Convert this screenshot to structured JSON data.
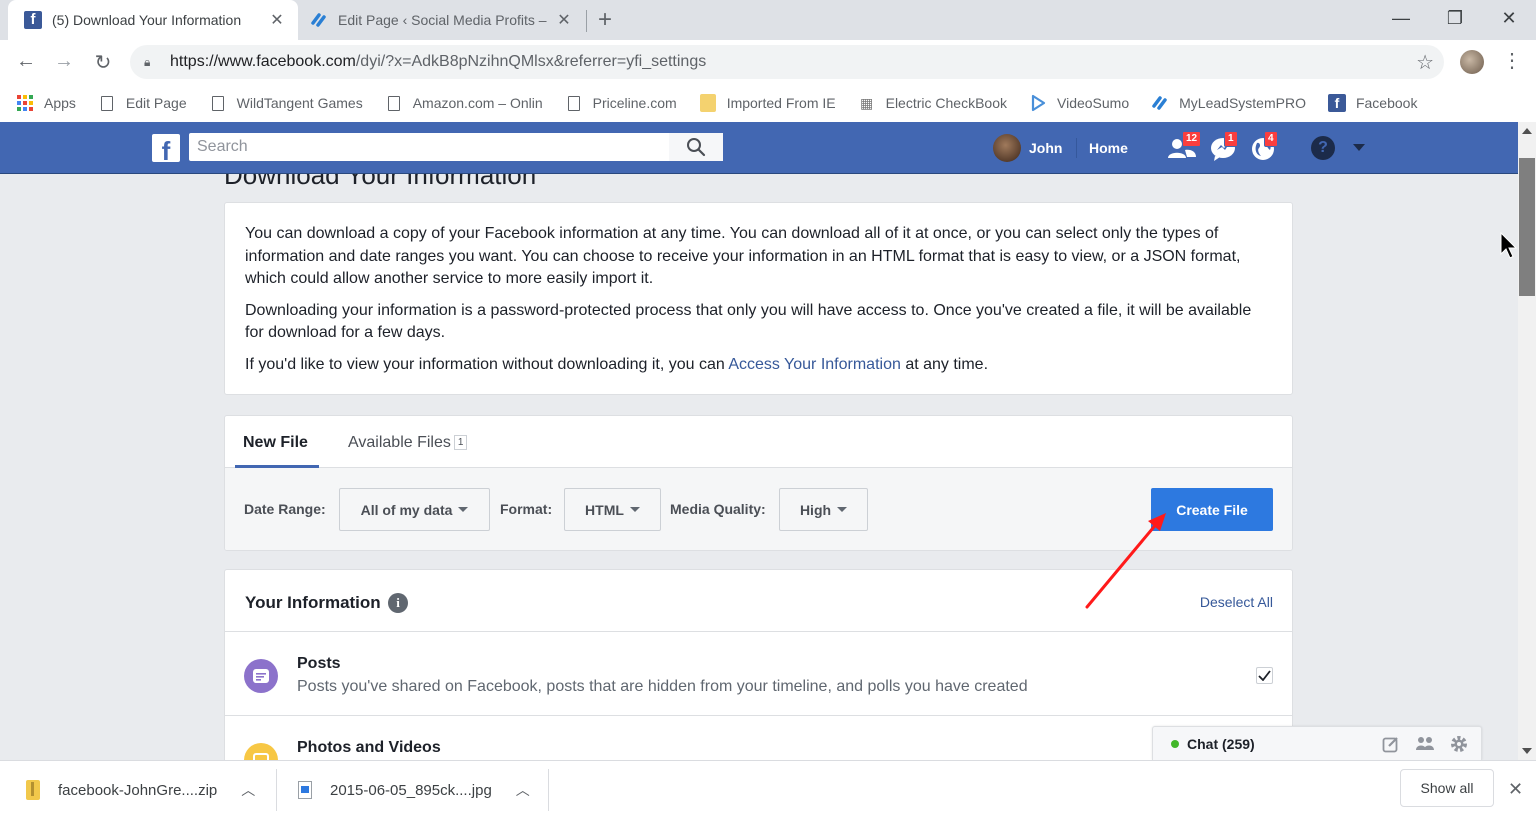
{
  "browser": {
    "tabs": [
      {
        "title": "(5) Download Your Information",
        "active": true,
        "icon": "facebook-icon"
      },
      {
        "title": "Edit Page ‹ Social Media Profits –",
        "active": false,
        "icon": "link-icon"
      }
    ],
    "new_tab_label": "+",
    "window_controls": {
      "minimize": "—",
      "restore": "❐",
      "close": "✕"
    },
    "url_host": "https://www.facebook.com",
    "url_path": "/dyi/?x=AdkB8pNzihnQMlsx&referrer=yfi_settings",
    "bookmarks": [
      {
        "label": "Apps",
        "icon": "apps-grid-icon"
      },
      {
        "label": "Edit Page",
        "icon": "page-icon"
      },
      {
        "label": "WildTangent Games",
        "icon": "page-icon"
      },
      {
        "label": "Amazon.com – Onlin",
        "icon": "page-icon"
      },
      {
        "label": "Priceline.com",
        "icon": "page-icon"
      },
      {
        "label": "Imported From IE",
        "icon": "folder-icon"
      },
      {
        "label": "Electric CheckBook",
        "icon": "checkbook-icon"
      },
      {
        "label": "VideoSumo",
        "icon": "play-icon"
      },
      {
        "label": "MyLeadSystemPRO",
        "icon": "link-icon"
      },
      {
        "label": "Facebook",
        "icon": "facebook-icon"
      }
    ]
  },
  "facebook": {
    "search_placeholder": "Search",
    "user_name": "John",
    "home_label": "Home",
    "notifications": {
      "friend_requests": "12",
      "messages": "1",
      "notifications": "4"
    },
    "help_label": "?"
  },
  "page": {
    "title": "Download Your Information",
    "intro": {
      "p1": "You can download a copy of your Facebook information at any time. You can download all of it at once, or you can select only the types of information and date ranges you want. You can choose to receive your information in an HTML format that is easy to view, or a JSON format, which could allow another service to more easily import it.",
      "p2": "Downloading your information is a password-protected process that only you will have access to. Once you've created a file, it will be available for download for a few days.",
      "p3_before": "If you'd like to view your information without downloading it, you can ",
      "p3_link": "Access Your Information",
      "p3_after": " at any time."
    },
    "file_tabs": {
      "new_file": "New File",
      "available_files": "Available Files",
      "available_count": "1"
    },
    "controls": {
      "date_range_label": "Date Range:",
      "date_range_value": "All of my data",
      "format_label": "Format:",
      "format_value": "HTML",
      "media_quality_label": "Media Quality:",
      "media_quality_value": "High",
      "create_button": "Create File"
    },
    "your_information": {
      "title": "Your Information",
      "deselect_all": "Deselect All",
      "categories": [
        {
          "title": "Posts",
          "description": "Posts you've shared on Facebook, posts that are hidden from your timeline, and polls you have created",
          "checked": true,
          "color": "#8c72cb"
        },
        {
          "title": "Photos and Videos",
          "description": "",
          "checked": true,
          "color": "#f7c744"
        }
      ]
    },
    "chat": {
      "label": "Chat (259)",
      "status_color": "#42b72a"
    }
  },
  "downloads": {
    "items": [
      {
        "name": "facebook-JohnGre....zip",
        "icon": "zip-file-icon"
      },
      {
        "name": "2015-06-05_895ck....jpg",
        "icon": "image-file-icon"
      }
    ],
    "show_all": "Show all"
  },
  "annotation": {
    "color": "#ff0000",
    "points_to": "Create File"
  }
}
